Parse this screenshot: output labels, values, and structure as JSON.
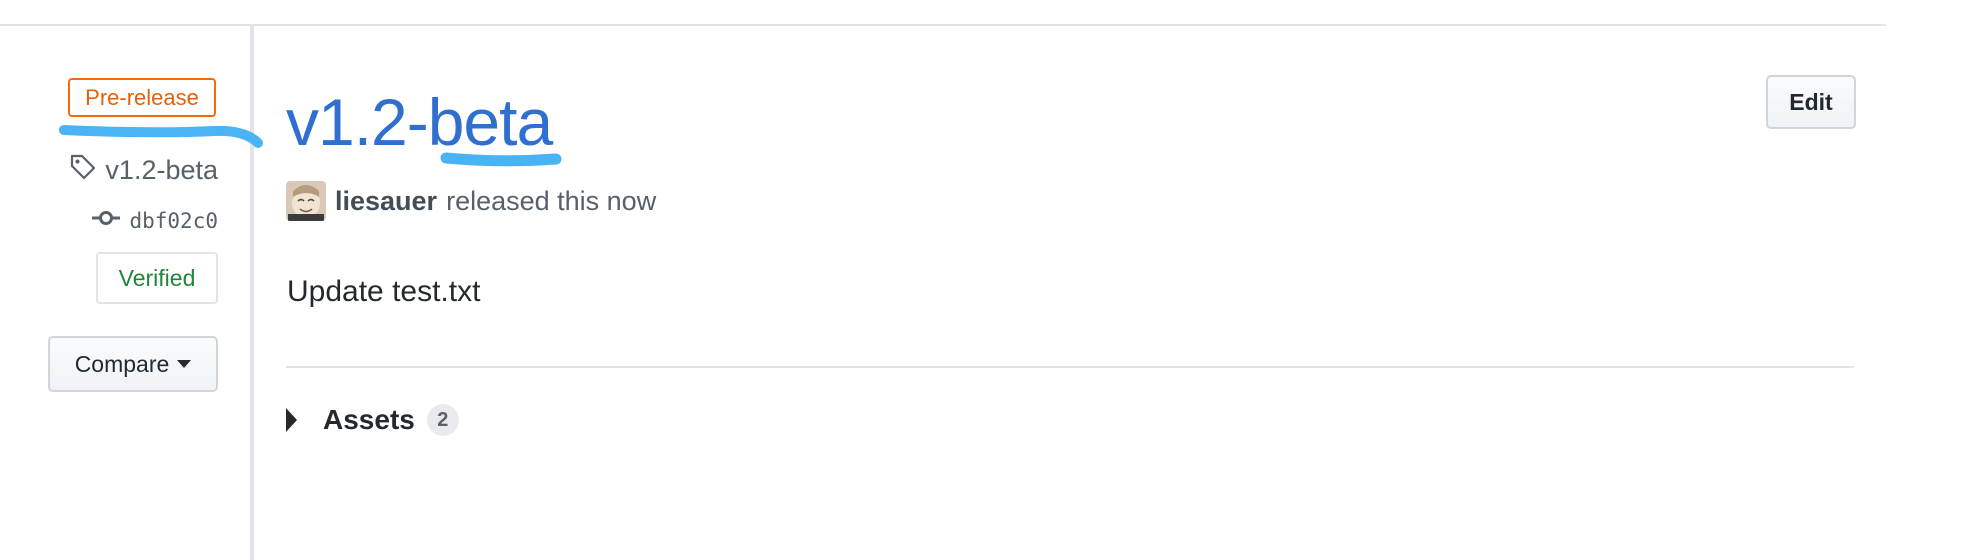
{
  "sidebar": {
    "prerelease_label": "Pre-release",
    "tag_name": "v1.2-beta",
    "tag_icon": "tag-icon",
    "commit_sha": "dbf02c0",
    "commit_icon": "git-commit-icon",
    "verified_label": "Verified",
    "compare_label": "Compare",
    "compare_icon": "caret-down-icon"
  },
  "release": {
    "title": "v1.2-beta",
    "author": "liesauer",
    "released_text": "released this now",
    "body": "Update test.txt",
    "assets_label": "Assets",
    "assets_count": "2",
    "assets_icon": "triangle-right-icon",
    "edit_label": "Edit"
  },
  "annotations": {
    "highlight_color": "#4ab3f4"
  },
  "colors": {
    "link_blue": "#2f6fd0",
    "prerelease_orange": "#e36209",
    "verified_green": "#22863a",
    "muted_text": "#586069"
  }
}
